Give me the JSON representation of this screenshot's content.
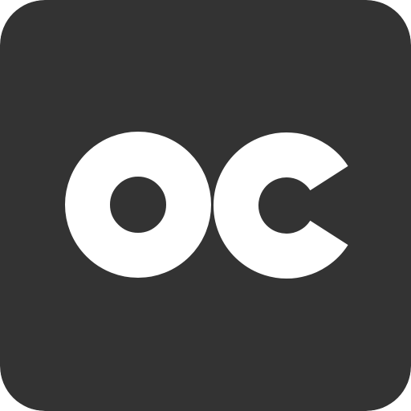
{
  "icon": {
    "monogram": "OC",
    "colors": {
      "background": "#333333",
      "glyph": "#ffffff"
    }
  }
}
